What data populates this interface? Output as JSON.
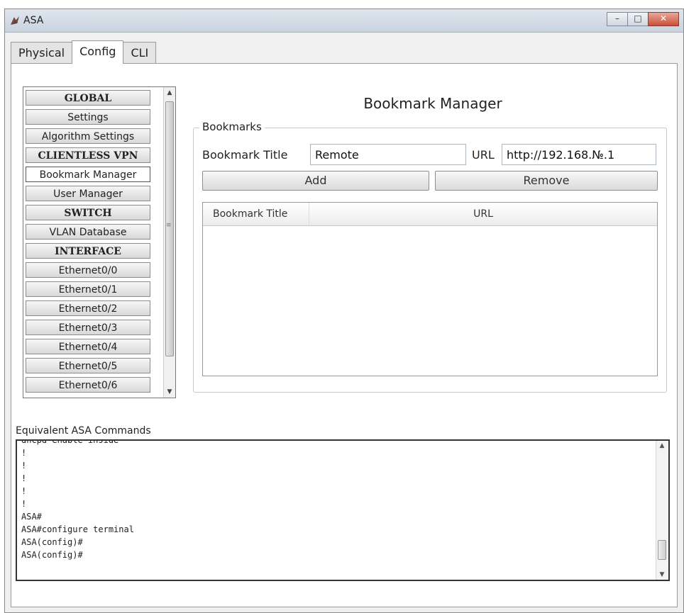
{
  "window": {
    "title": "ASA",
    "minimize_glyph": "–",
    "maximize_glyph": "□",
    "close_glyph": "✕"
  },
  "tabs": [
    {
      "label": "Physical"
    },
    {
      "label": "Config"
    },
    {
      "label": "CLI"
    }
  ],
  "active_tab": "Config",
  "sidebar": {
    "items": [
      {
        "label": "GLOBAL",
        "kind": "header"
      },
      {
        "label": "Settings",
        "kind": "item"
      },
      {
        "label": "Algorithm Settings",
        "kind": "item"
      },
      {
        "label": "CLIENTLESS VPN",
        "kind": "header"
      },
      {
        "label": "Bookmark Manager",
        "kind": "item",
        "selected": true
      },
      {
        "label": "User Manager",
        "kind": "item"
      },
      {
        "label": "SWITCH",
        "kind": "header"
      },
      {
        "label": "VLAN Database",
        "kind": "item"
      },
      {
        "label": "INTERFACE",
        "kind": "header"
      },
      {
        "label": "Ethernet0/0",
        "kind": "item"
      },
      {
        "label": "Ethernet0/1",
        "kind": "item"
      },
      {
        "label": "Ethernet0/2",
        "kind": "item"
      },
      {
        "label": "Ethernet0/3",
        "kind": "item"
      },
      {
        "label": "Ethernet0/4",
        "kind": "item"
      },
      {
        "label": "Ethernet0/5",
        "kind": "item"
      },
      {
        "label": "Ethernet0/6",
        "kind": "item"
      }
    ]
  },
  "main": {
    "title": "Bookmark Manager",
    "group_label": "Bookmarks",
    "bookmark_title_label": "Bookmark Title",
    "bookmark_title_value": "Remote",
    "url_label": "URL",
    "url_value": "http://192.168.№.1",
    "add_label": "Add",
    "remove_label": "Remove",
    "table": {
      "columns": [
        "Bookmark Title",
        "URL"
      ],
      "rows": []
    }
  },
  "console": {
    "label": "Equivalent ASA Commands",
    "lines": [
      "dhcpd enable inside",
      "!",
      "!",
      "!",
      "!",
      "!",
      "ASA#",
      "ASA#configure terminal",
      "ASA(config)#",
      "ASA(config)#"
    ]
  },
  "colors": {
    "accent": "#ffffff",
    "frame": "#9a9a9a",
    "console_border": "#333333"
  }
}
